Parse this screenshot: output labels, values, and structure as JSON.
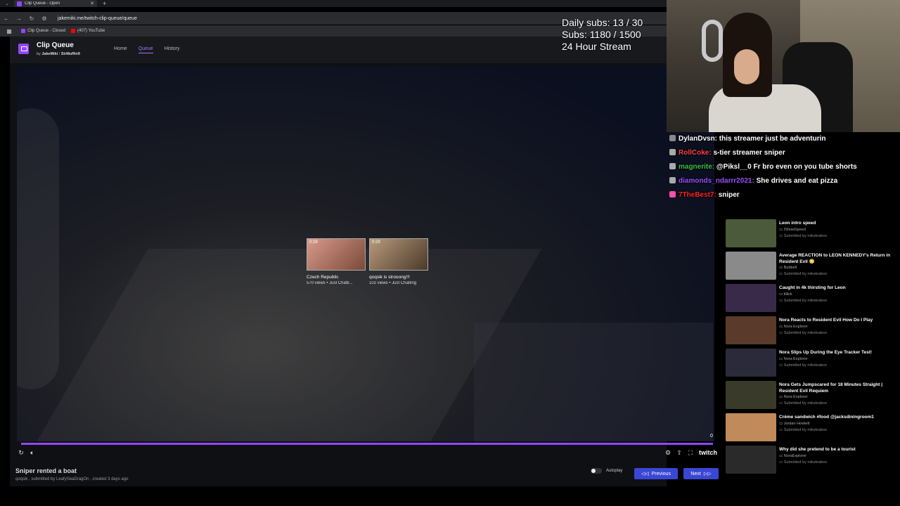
{
  "browser": {
    "tab_title": "Clip Queue - Open",
    "url": "jakemiki.me/twitch-clip-queue/queue",
    "bookmarks": [
      {
        "label": "Clip Queue - Closed",
        "color": "#9146ff"
      },
      {
        "label": "(407) YouTube",
        "color": "#ff0000"
      }
    ]
  },
  "site": {
    "title": "Clip Queue",
    "subtitle_by": "by",
    "author1": "JakeMiki",
    "author2": "SirMuffin9",
    "nav": [
      "Home",
      "Queue",
      "History"
    ],
    "active_nav": "Queue"
  },
  "overlay": {
    "daily_subs": "Daily subs: 13 / 30",
    "subs": "Subs: 1180 / 1500",
    "stream": "24 Hour Stream"
  },
  "related_clips": [
    {
      "duration": "0:29",
      "title": "Czech Republic",
      "meta": "570 views • Just Chatti..."
    },
    {
      "duration": "0:29",
      "title": "qoqsik is strooong!!!",
      "meta": "102 views • Just Chatting"
    }
  ],
  "player": {
    "time": "0",
    "brand": "twitch",
    "progress": 1.0
  },
  "clip": {
    "title": "Sniper rented a boat",
    "meta": "qoqsik , submitted by LeafySeaDragOn , created 3 days ago"
  },
  "autoplay_label": "Autoplay",
  "buttons": {
    "previous": "Previous",
    "next": "Next"
  },
  "chat": [
    {
      "user": "DylanDvsn:",
      "color": "#ffffff",
      "text": "this streamer just be adventurin"
    },
    {
      "user": "RollCoke:",
      "color": "#ff4040",
      "text": "s-tier streamer sniper"
    },
    {
      "user": "magnerite:",
      "color": "#3fbf3f",
      "text": "@Piksl__0 Fr bro even on you tube shorts"
    },
    {
      "user": "diamonds_ndarrr2021:",
      "color": "#9b4dff",
      "text": "She drives and eat pizza"
    },
    {
      "user": "7TheBest7:",
      "color": "#ff2222",
      "text": "sniper"
    }
  ],
  "queue": [
    {
      "title": "Leon intro speed",
      "channel": "IShowSpeed",
      "by": "Submitted by mikeleabox",
      "color": "#4a5a3a"
    },
    {
      "title": "Average REACTION to LEON KENNEDY's Return in Resident Evil 😳",
      "channel": "Bubbell",
      "by": "Submitted by mikeleabox",
      "color": "#8a8a8a"
    },
    {
      "title": "Caught in 4k thirsting for Leon",
      "channel": "tillick",
      "by": "Submitted by mikeleabox",
      "color": "#3a2a4a"
    },
    {
      "title": "Nora Reacts to Resident Evil How Do I Play",
      "channel": "Nora Explorer",
      "by": "Submitted by mikeleabox",
      "color": "#5a3a2a"
    },
    {
      "title": "Nora Slips Up During the Eye Tracker Test!",
      "channel": "Nora Explorer",
      "by": "Submitted by mikeleabox",
      "color": "#2a2a3a"
    },
    {
      "title": "Nora Gets Jumpscared for 18 Minutes Straight | Resident Evil Requiem",
      "channel": "Nora Explorer",
      "by": "Submitted by mikeleabox",
      "color": "#3a3a2a"
    },
    {
      "title": "Crème sandwich #food @jacksdiningroom1",
      "channel": "Jordan Howlett",
      "by": "Submitted by mikeleabox",
      "color": "#c08a5a"
    },
    {
      "title": "Why did she pretend to be a tourist",
      "channel": "NoraExplorer",
      "by": "Submitted by mikeleabox",
      "color": "#2a2a2a"
    }
  ]
}
